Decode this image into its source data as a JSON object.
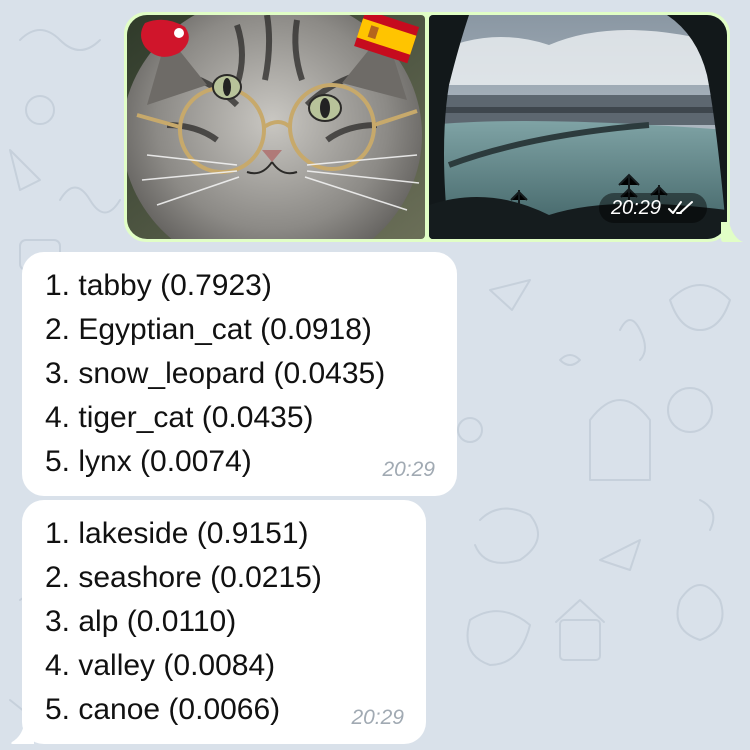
{
  "outgoing_album": {
    "time": "20:29",
    "status": "read",
    "photos": [
      {
        "subject": "tabby cat wearing round glasses",
        "sticker": "spain-flag"
      },
      {
        "subject": "lakeside landscape"
      }
    ]
  },
  "replies": [
    {
      "lines": [
        "1. tabby (0.7923)",
        "2. Egyptian_cat (0.0918)",
        "3. snow_leopard (0.0435)",
        "4. tiger_cat (0.0435)",
        "5. lynx (0.0074)"
      ],
      "time": "20:29"
    },
    {
      "lines": [
        "1. lakeside (0.9151)",
        "2. seashore (0.0215)",
        "3. alp (0.0110)",
        "4. valley (0.0084)",
        "5. canoe (0.0066)"
      ],
      "time": "20:29"
    }
  ],
  "colors": {
    "background": "#d9e1ea",
    "outgoing_bubble": "#e1fec6",
    "incoming_bubble": "#ffffff",
    "timestamp": "#a1aab3"
  }
}
